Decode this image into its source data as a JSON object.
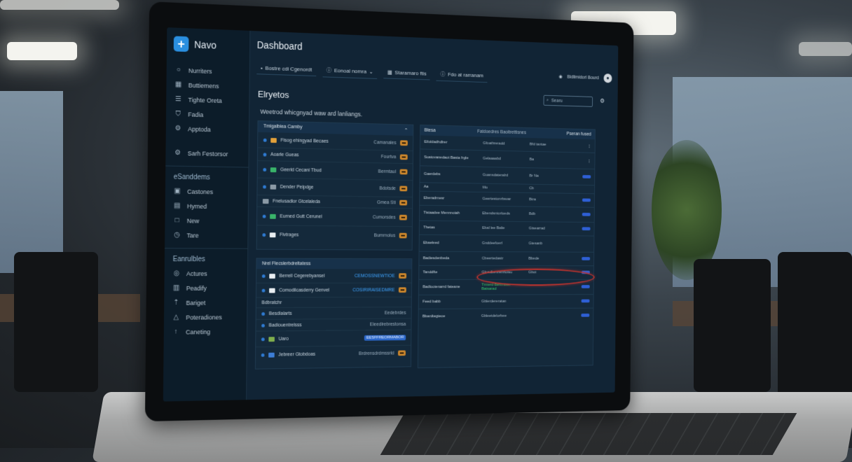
{
  "app": {
    "name": "Navo"
  },
  "sidebar": {
    "items": [
      {
        "label": "Nurriters",
        "icon": "circle-icon"
      },
      {
        "label": "Buttiemens",
        "icon": "grid-icon"
      },
      {
        "label": "Tighte Oreta",
        "icon": "list-icon"
      },
      {
        "label": "Fadia",
        "icon": "shield-icon"
      },
      {
        "label": "Apptoda",
        "icon": "gear-icon"
      },
      {
        "label": "Sarh Festorsor",
        "icon": "gear-icon"
      }
    ],
    "section1": "eSanddems",
    "items2": [
      {
        "label": "Castones",
        "icon": "box-icon"
      },
      {
        "label": "Hyrned",
        "icon": "image-icon"
      },
      {
        "label": "New",
        "icon": "square-icon"
      },
      {
        "label": "Tare",
        "icon": "clock-icon"
      }
    ],
    "section2": "Eanrulbles",
    "items3": [
      {
        "label": "Actures",
        "icon": "circle-icon"
      },
      {
        "label": "Peadify",
        "icon": "calendar-icon"
      },
      {
        "label": "Bariget",
        "icon": "arrow-up-icon"
      },
      {
        "label": "Poteradiones",
        "icon": "triangle-icon"
      },
      {
        "label": "Caneting",
        "icon": "arrow-up-icon"
      }
    ]
  },
  "header": {
    "title": "Dashboard",
    "tabs": [
      {
        "label": "Bostre cdi Cgenordt"
      },
      {
        "label": "Eonoal nomra"
      },
      {
        "label": "Staramaro ftis"
      },
      {
        "label": "Fdo at rarranam"
      }
    ],
    "user_label": "Bidlimidorl Bourd",
    "search_placeholder": "Searu"
  },
  "main": {
    "section_title": "Elryetos",
    "subtitle": "Weetrod whicgnyad waw ard lanliangs.",
    "list_panel": {
      "header": "Tmigalbiea Carnby",
      "rows": [
        {
          "name": "Fisog ehingyad Becaes",
          "meta": "Camanales",
          "badge": ""
        },
        {
          "name": "Aoarle Gueas",
          "meta": "Fourtva",
          "badge": ""
        },
        {
          "name": "Geerld Cecani Tbud",
          "meta": "Bermtaul",
          "badge": ""
        },
        {
          "name": "Dender Pelpdge",
          "meta": "Bdotsde",
          "badge": ""
        },
        {
          "name": "Fnelusadlor Gtcelaleda",
          "meta": "Gmea Sti",
          "badge": ""
        },
        {
          "name": "Eurned Gutt Cerunel",
          "meta": "Cumorsdes",
          "badge": ""
        },
        {
          "name": "Flvtrages",
          "meta": "Bumrnolus",
          "badge": ""
        }
      ]
    },
    "lower_panel": {
      "header": "Nrel Flecslerbdreltatess",
      "rows": [
        {
          "name": "Berrell Cegerebyansel",
          "right": "CEMOSSNEWTIOE"
        },
        {
          "name": "Comodilcasderry Genvel",
          "right": "COSIRIRAISEDMRE"
        },
        {
          "name": "Bdbratchr",
          "right": ""
        },
        {
          "name": "Besdlalarts",
          "right": "Eedebrdes"
        },
        {
          "name": "Badlouentrelsss",
          "right": "Eleedlrebrestonsa"
        },
        {
          "name": "Uaro",
          "right": "EESFFREORMABOR"
        },
        {
          "name": "Jebreer Gtobdoas",
          "right": "Brdrensdrdmssrld"
        }
      ]
    },
    "table": {
      "tabs": [
        "Btesa",
        "Fatdoedres Baoltrettisnes"
      ],
      "action": "Pseran fused",
      "rows": [
        {
          "c1": "Eiloldadhdlrer",
          "c2": "Gfoathreradd",
          "c3": "Bfd tantae",
          "c4": ""
        },
        {
          "c1": "Suatovanedaot Basta frgle",
          "c2": "Gelaaaabd",
          "c3": "Ba",
          "c4": ""
        },
        {
          "c1": "Gaerdebs",
          "c2": "Guansdateralrd",
          "c3": "Br Na",
          "c4": ""
        },
        {
          "c1": "Aa",
          "c2": "Mo",
          "c3": "Cb",
          "c4": ""
        },
        {
          "c1": "Eberadrnesr",
          "c2": "Geertestonrbsvar",
          "c3": "Btra",
          "c4": ""
        },
        {
          "c1": "Tistaadee Mennnoiah",
          "c2": "Ebendsntorloeds",
          "c3": "Bdb",
          "c4": ""
        },
        {
          "c1": "Thetas",
          "c2": "Ebal lee Balie",
          "c3": "Gtsearrad",
          "c4": ""
        },
        {
          "c1": "Ebaeleed",
          "c2": "Gnddeefoerl",
          "c3": "Gtesanb",
          "c4": ""
        },
        {
          "c1": "Badiesdenbeda",
          "c2": "Cbeertedastr",
          "c3": "Bbede",
          "c4": ""
        },
        {
          "c1": "Tanddfte",
          "c2": "Gloadbenrenrtotsu",
          "c3": "Gbot",
          "c4": ""
        },
        {
          "c1": "Badlootenarrd fateane",
          "c2": "Trmerd Berbnteer Batsarad",
          "c3": "",
          "c4": ""
        },
        {
          "c1": "Feed babb",
          "c2": "Gblerdereratan",
          "c3": "",
          "c4": ""
        },
        {
          "c1": "Bbardtegteoe",
          "c2": "Gbleetdelorbee",
          "c3": "",
          "c4": ""
        }
      ]
    }
  }
}
